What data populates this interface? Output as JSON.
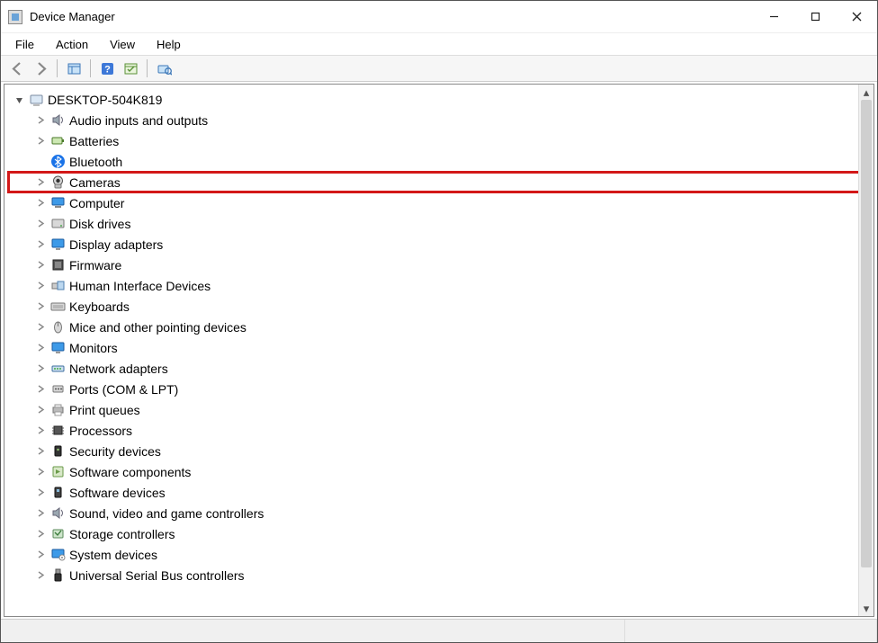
{
  "window": {
    "title": "Device Manager"
  },
  "menu": {
    "file": "File",
    "action": "Action",
    "view": "View",
    "help": "Help"
  },
  "tree": {
    "root": "DESKTOP-504K819",
    "items": [
      {
        "label": "Audio inputs and outputs",
        "icon": "speaker",
        "highlighted": false
      },
      {
        "label": "Batteries",
        "icon": "battery",
        "highlighted": false
      },
      {
        "label": "Bluetooth",
        "icon": "bluetooth",
        "highlighted": false,
        "noExpander": true
      },
      {
        "label": "Cameras",
        "icon": "camera",
        "highlighted": true
      },
      {
        "label": "Computer",
        "icon": "computer",
        "highlighted": false
      },
      {
        "label": "Disk drives",
        "icon": "disk",
        "highlighted": false
      },
      {
        "label": "Display adapters",
        "icon": "display",
        "highlighted": false
      },
      {
        "label": "Firmware",
        "icon": "firmware",
        "highlighted": false
      },
      {
        "label": "Human Interface Devices",
        "icon": "hid",
        "highlighted": false
      },
      {
        "label": "Keyboards",
        "icon": "keyboard",
        "highlighted": false
      },
      {
        "label": "Mice and other pointing devices",
        "icon": "mouse",
        "highlighted": false
      },
      {
        "label": "Monitors",
        "icon": "monitor",
        "highlighted": false
      },
      {
        "label": "Network adapters",
        "icon": "network",
        "highlighted": false
      },
      {
        "label": "Ports (COM & LPT)",
        "icon": "port",
        "highlighted": false
      },
      {
        "label": "Print queues",
        "icon": "printer",
        "highlighted": false
      },
      {
        "label": "Processors",
        "icon": "processor",
        "highlighted": false
      },
      {
        "label": "Security devices",
        "icon": "security",
        "highlighted": false
      },
      {
        "label": "Software components",
        "icon": "software",
        "highlighted": false
      },
      {
        "label": "Software devices",
        "icon": "software2",
        "highlighted": false
      },
      {
        "label": "Sound, video and game controllers",
        "icon": "sound",
        "highlighted": false
      },
      {
        "label": "Storage controllers",
        "icon": "storage",
        "highlighted": false
      },
      {
        "label": "System devices",
        "icon": "system",
        "highlighted": false
      },
      {
        "label": "Universal Serial Bus controllers",
        "icon": "usb",
        "highlighted": false
      }
    ]
  }
}
